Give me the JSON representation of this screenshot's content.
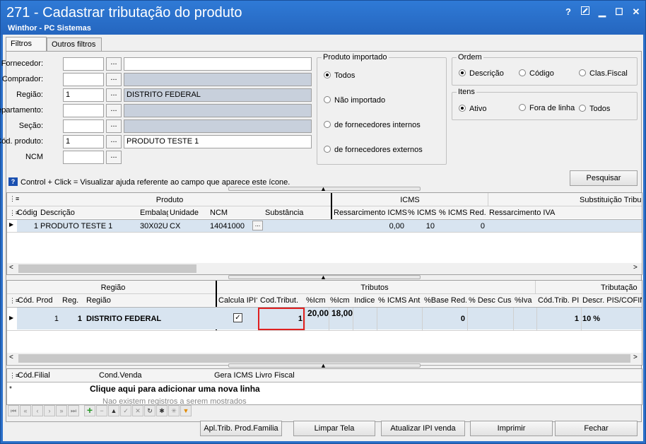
{
  "window": {
    "title": "271 - Cadastrar tributação do produto",
    "subtitle": "Winthor - PC Sistemas",
    "help_glyph": "?",
    "minimize_glyph": "▁",
    "maximize_glyph": "☐",
    "close_glyph": "✕"
  },
  "tabs": [
    {
      "label": "Filtros"
    },
    {
      "label": "Outros filtros"
    }
  ],
  "filters": {
    "fornecedor": {
      "label": "Fornecedor:",
      "value": "",
      "desc": ""
    },
    "comprador": {
      "label": "Comprador:",
      "value": "",
      "desc": ""
    },
    "regiao": {
      "label": "Região:",
      "value": "1",
      "desc": "DISTRITO FEDERAL"
    },
    "departamento": {
      "label": "Departamento:",
      "value": "",
      "desc": ""
    },
    "secao": {
      "label": "Seção:",
      "value": "",
      "desc": ""
    },
    "cod_produto": {
      "label": "Cód. produto:",
      "value": "1",
      "desc": "PRODUTO TESTE 1"
    },
    "ncm": {
      "label": "NCM",
      "value": ""
    },
    "ellipsis": "..."
  },
  "produto_importado": {
    "title": "Produto importado",
    "options": [
      "Todos",
      "Não importado",
      "de fornecedores internos",
      "de fornecedores externos"
    ],
    "selected": 0
  },
  "ordem": {
    "title": "Ordem",
    "options": [
      "Descrição",
      "Código",
      "Clas.Fiscal"
    ],
    "selected": 0
  },
  "itens": {
    "title": "Itens",
    "options": [
      "Ativo",
      "Fora de linha",
      "Todos"
    ],
    "selected": 0
  },
  "help_hint": "Control + Click = Visualizar ajuda referente ao campo que aparece este ícone.",
  "pesquisar_label": "Pesquisar",
  "grid1": {
    "band_produto": "Produto",
    "band_icms": "ICMS",
    "band_st": "Substituição Tribu",
    "columns": [
      "Códig",
      "Descrição",
      "Embalag",
      "Unidade",
      "NCM",
      "Substância",
      "Ressarcimento ICMS",
      "% ICMS",
      "% ICMS Red.",
      "Ressarcimento IVA"
    ],
    "row": {
      "codigo": "1",
      "descricao": "PRODUTO TESTE 1",
      "embalagem": "30X02U",
      "unidade": "CX",
      "ncm": "14041000",
      "ncm_btn": "...",
      "ressarc_icms": "0,00",
      "pct_icms": "10",
      "pct_icms_red": "0"
    }
  },
  "grid2": {
    "band_regiao": "Região",
    "band_tributos": "Tributos",
    "band_tributacao": "Tributação",
    "columns": [
      "Cód. Prod",
      "Reg.",
      "Região",
      "Calcula IPI?",
      "Cod.Tribut.",
      "%Icm",
      "%Icm",
      "Indice",
      "% ICMS Ant",
      "%Base Red.",
      "% Desc Cus",
      "%Iva",
      "Cód.Trib. PI",
      "Descr. PIS/COFIN"
    ],
    "row": {
      "cod_prod": "1",
      "reg": "1",
      "regiao": "DISTRITO FEDERAL",
      "calcula_ipi": true,
      "cod_tribut": "1",
      "icm1": "20,00",
      "icm2": "18,00",
      "base_red": "0",
      "cod_trib_pi": "1",
      "descr_pis": "10 %"
    }
  },
  "grid3": {
    "columns": [
      "Cód.Filial",
      "Cond.Venda",
      "Gera ICMS Livro Fiscal"
    ],
    "add_row_text": "Clique aqui para adicionar uma nova linha",
    "empty_text": "Nao existem registros a serem mostrados"
  },
  "footer_buttons": [
    {
      "label": "Apl.Trib. Prod.Familia"
    },
    {
      "label": "Limpar Tela"
    },
    {
      "label": "Atualizar IPI venda"
    },
    {
      "label": "Imprimir"
    },
    {
      "label": "Fechar"
    }
  ],
  "colors": {
    "title_bar": "#2a6fc9",
    "highlight_box": "#e02020",
    "selected_row": "#d8e4f0",
    "add_icon": "#2a9a2a",
    "filter_icon": "#e08a00"
  }
}
